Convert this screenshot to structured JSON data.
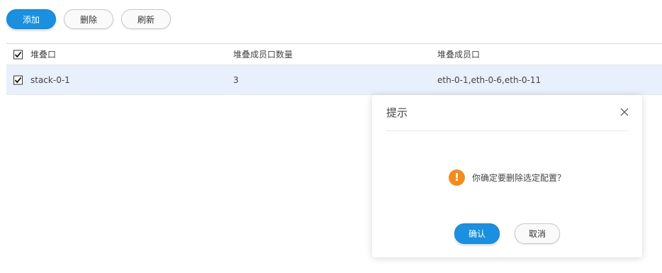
{
  "toolbar": {
    "add_label": "添加",
    "delete_label": "删除",
    "refresh_label": "刷新"
  },
  "table": {
    "columns": [
      "堆叠口",
      "堆叠成员口数量",
      "堆叠成员口"
    ],
    "rows": [
      {
        "checked": true,
        "name": "stack-0-1",
        "member_count": "3",
        "members": "eth-0-1,eth-0-6,eth-0-11"
      }
    ]
  },
  "dialog": {
    "title": "提示",
    "message": "你确定要删除选定配置？",
    "icon": "warning-icon",
    "ok_label": "确认",
    "cancel_label": "取消"
  },
  "colors": {
    "primary": "#1b8fe0",
    "warning": "#f28c1e",
    "row_selected": "#e8f0fb"
  }
}
